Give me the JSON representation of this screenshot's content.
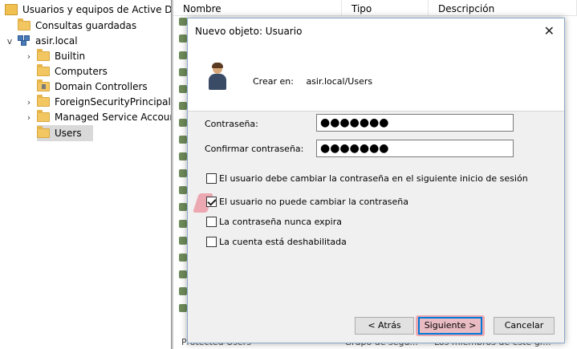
{
  "tree": {
    "root_label": "Usuarios y equipos de Active Dir",
    "saved_queries": "Consultas guardadas",
    "domain": "asir.local",
    "items": [
      {
        "label": "Builtin",
        "expander": "›"
      },
      {
        "label": "Computers",
        "expander": ""
      },
      {
        "label": "Domain Controllers",
        "expander": ""
      },
      {
        "label": "ForeignSecurityPrincipals",
        "expander": "›"
      },
      {
        "label": "Managed Service Accour",
        "expander": "›"
      },
      {
        "label": "Users",
        "expander": ""
      }
    ],
    "domain_expander": "v"
  },
  "list": {
    "columns": [
      "Nombre",
      "Tipo",
      "Descripción"
    ],
    "bottom_row": {
      "name": "Protected Users",
      "type": "Grupo de segu...",
      "desc": "Los miembros de este gr..."
    }
  },
  "dialog": {
    "title": "Nuevo objeto: Usuario",
    "close_symbol": "✕",
    "create_in_label": "Crear en:",
    "create_in_path": "asir.local/Users",
    "password_label": "Contraseña:",
    "password_value": "●●●●●●●",
    "confirm_label": "Confirmar contraseña:",
    "confirm_value": "●●●●●●●",
    "options": [
      {
        "label": "El usuario debe cambiar la contraseña en el siguiente inicio de sesión",
        "checked": false
      },
      {
        "label": "El usuario no puede cambiar la contraseña",
        "checked": true
      },
      {
        "label": "La contraseña nunca expira",
        "checked": false
      },
      {
        "label": "La cuenta está deshabilitada",
        "checked": false
      }
    ],
    "buttons": {
      "back": "< Atrás",
      "next": "Siguiente >",
      "cancel": "Cancelar"
    }
  },
  "colors": {
    "highlight": "#e86e7d",
    "default_button_border": "#0078d7"
  }
}
